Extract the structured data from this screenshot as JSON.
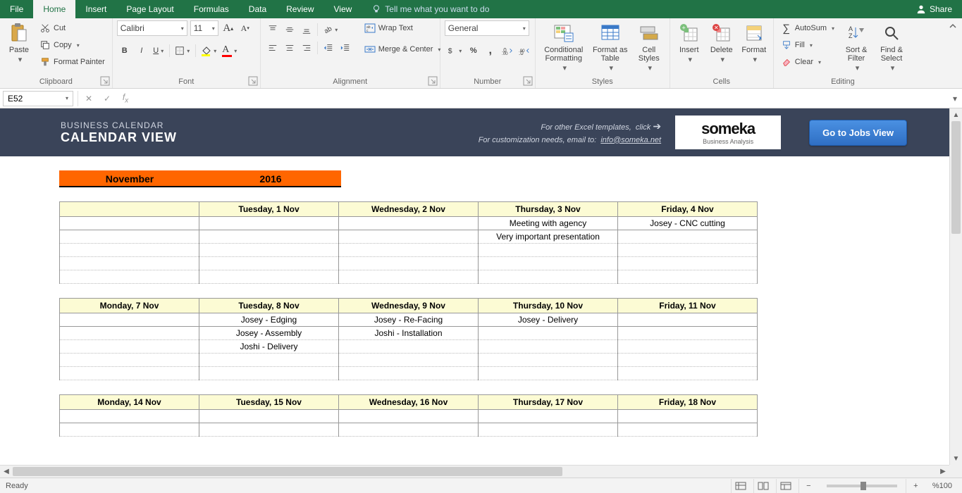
{
  "tabs": [
    "File",
    "Home",
    "Insert",
    "Page Layout",
    "Formulas",
    "Data",
    "Review",
    "View"
  ],
  "active_tab": "Home",
  "tellme": "Tell me what you want to do",
  "share": "Share",
  "clipboard": {
    "paste": "Paste",
    "cut": "Cut",
    "copy": "Copy",
    "format_painter": "Format Painter",
    "label": "Clipboard"
  },
  "font": {
    "name": "Calibri",
    "size": "11",
    "label": "Font"
  },
  "alignment": {
    "wrap": "Wrap Text",
    "merge": "Merge & Center",
    "label": "Alignment"
  },
  "number": {
    "format": "General",
    "label": "Number"
  },
  "styles": {
    "conditional": "Conditional Formatting",
    "format_as": "Format as Table",
    "cell_styles": "Cell Styles",
    "label": "Styles"
  },
  "cells": {
    "insert": "Insert",
    "delete": "Delete",
    "format": "Format",
    "label": "Cells"
  },
  "editing": {
    "autosum": "AutoSum",
    "fill": "Fill",
    "clear": "Clear",
    "sort": "Sort & Filter",
    "find": "Find & Select",
    "label": "Editing"
  },
  "name_box": "E52",
  "calendar": {
    "subtitle": "BUSINESS CALENDAR",
    "title": "CALENDAR VIEW",
    "other_templates": "For other Excel templates,",
    "click": "click",
    "customization": "For customization needs, email to:",
    "email": "info@someka.net",
    "logo_brand": "someka",
    "logo_sub": "Business Analysis",
    "jobs_button": "Go to Jobs View",
    "month": "November",
    "year": "2016",
    "weeks": [
      {
        "headers": [
          "",
          "Tuesday, 1 Nov",
          "Wednesday, 2 Nov",
          "Thursday, 3 Nov",
          "Friday, 4 Nov"
        ],
        "rows": [
          [
            "",
            "",
            "",
            "Meeting with agency",
            "Josey - CNC cutting"
          ],
          [
            "",
            "",
            "",
            "Very important presentation",
            ""
          ],
          [
            "",
            "",
            "",
            "",
            ""
          ],
          [
            "",
            "",
            "",
            "",
            ""
          ],
          [
            "",
            "",
            "",
            "",
            ""
          ]
        ]
      },
      {
        "headers": [
          "Monday, 7 Nov",
          "Tuesday, 8 Nov",
          "Wednesday, 9 Nov",
          "Thursday, 10 Nov",
          "Friday, 11 Nov"
        ],
        "rows": [
          [
            "",
            "Josey - Edging",
            "Josey - Re-Facing",
            "Josey - Delivery",
            ""
          ],
          [
            "",
            "Josey - Assembly",
            "Joshi - Installation",
            "",
            ""
          ],
          [
            "",
            "Joshi - Delivery",
            "",
            "",
            ""
          ],
          [
            "",
            "",
            "",
            "",
            ""
          ],
          [
            "",
            "",
            "",
            "",
            ""
          ]
        ]
      },
      {
        "headers": [
          "Monday, 14 Nov",
          "Tuesday, 15 Nov",
          "Wednesday, 16 Nov",
          "Thursday, 17 Nov",
          "Friday, 18 Nov"
        ],
        "rows": [
          [
            "",
            "",
            "",
            "",
            ""
          ],
          [
            "",
            "",
            "",
            "",
            ""
          ]
        ]
      }
    ]
  },
  "status": {
    "ready": "Ready",
    "zoom": "%100"
  }
}
